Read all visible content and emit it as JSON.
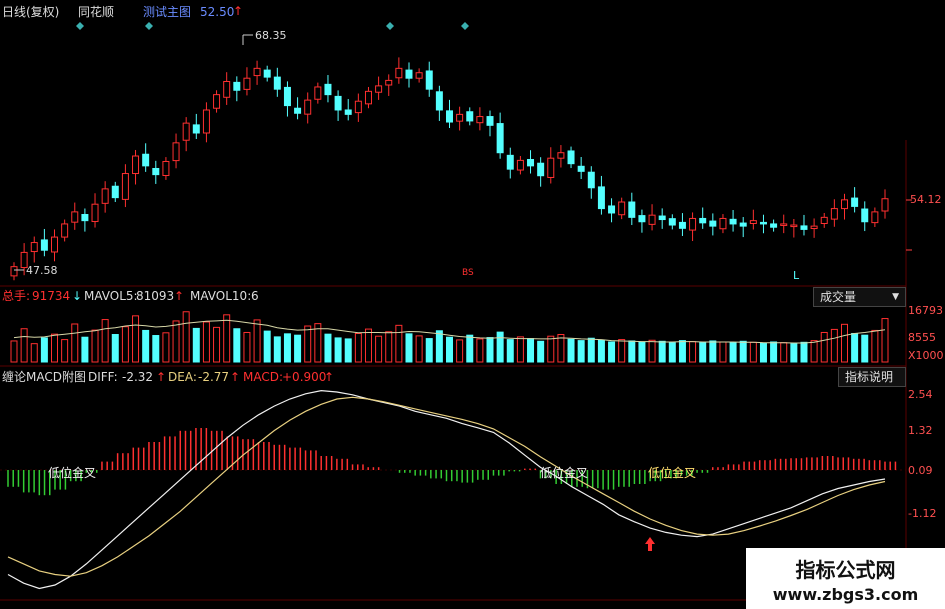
{
  "header": {
    "period_label": "日线(复权)",
    "software_label": "同花顺",
    "main_indicator_label": "测试主图",
    "main_indicator_value": "52.50"
  },
  "main": {
    "high_label": "68.35",
    "low_label": "47.58",
    "right_price": "54.12",
    "bottom_marker": "L"
  },
  "volume": {
    "total_label": "总手:",
    "total_value": "91734",
    "mavol5_label": "MAVOL5:",
    "mavol5_value": "81093",
    "mavol10_label": "MAVOL10:",
    "mavol10_value": "6",
    "selector_label": "成交量",
    "axis_top": "16793",
    "axis_mid": "8555",
    "axis_unit": "X1000"
  },
  "macd": {
    "title": "缠论MACD附图",
    "diff_label": "DIFF:",
    "diff_value": "-2.32",
    "dea_label": "DEA:",
    "dea_value": "-2.77",
    "macd_label": "MACD:",
    "macd_value": "+0.900",
    "help_button": "指标说明",
    "axis": [
      "2.54",
      "1.32",
      "0.09",
      "-1.12"
    ],
    "annotations": [
      "低位金叉",
      "低位金叉",
      "低位金叉"
    ]
  },
  "watermark": {
    "line1": "指标公式网",
    "line2": "www.zbgs3.com"
  },
  "chart_data": [
    {
      "type": "candlestick",
      "annotations": [
        "68.35",
        "47.58",
        "54.12"
      ],
      "up_color": "#ff3030",
      "down_color": "#54ffff",
      "close": [
        47.9,
        49.2,
        50.1,
        49.4,
        50.6,
        51.8,
        52.9,
        52.1,
        53.6,
        55.0,
        54.2,
        56.4,
        58.0,
        57.1,
        56.3,
        57.5,
        59.2,
        61.0,
        60.1,
        62.2,
        63.6,
        64.8,
        64.0,
        65.1,
        66.0,
        65.2,
        64.1,
        62.6,
        61.9,
        63.1,
        64.3,
        63.6,
        62.2,
        61.8,
        63.0,
        63.9,
        64.4,
        64.9,
        66.0,
        65.1,
        65.6,
        64.1,
        62.2,
        61.1,
        61.8,
        61.2,
        61.6,
        60.8,
        58.3,
        56.8,
        57.6,
        57.1,
        56.2,
        57.8,
        58.3,
        57.3,
        56.6,
        55.1,
        53.2,
        52.8,
        53.8,
        52.4,
        52.0,
        52.6,
        52.2,
        51.7,
        51.4,
        52.3,
        51.9,
        51.6,
        52.3,
        51.8,
        51.6,
        52.1,
        51.8,
        51.5,
        51.8,
        51.7,
        51.3,
        51.6,
        52.4,
        53.2,
        54.0,
        53.4,
        52.0,
        52.9,
        54.1
      ],
      "high_marker": 68.35,
      "low_marker": 47.58
    },
    {
      "type": "bar",
      "name": "成交量",
      "axis_ticks": [
        "16793",
        "8555"
      ],
      "values": [
        6200,
        9800,
        5400,
        7100,
        8200,
        6600,
        11200,
        7300,
        9400,
        12500,
        8100,
        10400,
        13600,
        9300,
        7800,
        8600,
        12100,
        14800,
        9900,
        11800,
        10200,
        13900,
        9800,
        8700,
        12400,
        9100,
        7400,
        8300,
        7900,
        10600,
        11300,
        8200,
        7100,
        6800,
        8400,
        9700,
        7600,
        8900,
        10800,
        8300,
        7700,
        6900,
        9200,
        7300,
        6500,
        7900,
        6800,
        7200,
        8800,
        6600,
        7400,
        6900,
        6100,
        7600,
        8100,
        6700,
        6300,
        7000,
        6400,
        5900,
        6600,
        6200,
        5800,
        6400,
        6100,
        5700,
        6300,
        6000,
        5800,
        6200,
        5900,
        5600,
        6100,
        5800,
        5500,
        5900,
        5700,
        5400,
        5800,
        6300,
        8700,
        9600,
        11100,
        8400,
        7900,
        9300,
        12800
      ],
      "mavol5": [
        7200,
        7500,
        7300,
        7400,
        7900,
        8200,
        8500,
        8900,
        9200,
        9800,
        10100,
        10600,
        10900,
        10700,
        10300,
        10500,
        10900,
        11400,
        11700,
        12000,
        12100,
        12300,
        12000,
        11600,
        11200,
        10800,
        10100,
        9700,
        9400,
        9500,
        9800,
        9800,
        9400,
        9000,
        8600,
        8700,
        8700,
        8600,
        8700,
        9000,
        8900,
        8600,
        8300,
        7900,
        7500,
        7300,
        7100,
        7000,
        7200,
        7000,
        6900,
        6900,
        6800,
        6800,
        7100,
        7000,
        6800,
        6700,
        6600,
        6300,
        6200,
        6100,
        6000,
        6000,
        5900,
        5900,
        6000,
        6000,
        5900,
        5900,
        5900,
        5900,
        5800,
        5800,
        5700,
        5700,
        5700,
        5600,
        5600,
        5800,
        6400,
        7000,
        7800,
        8400,
        8700,
        9100,
        9500
      ]
    },
    {
      "type": "line",
      "title": "缠论MACD附图",
      "series": [
        {
          "name": "DIFF",
          "values": [
            -2.7,
            -2.95,
            -3.1,
            -3.0,
            -2.75,
            -2.4,
            -2.0,
            -1.6,
            -1.2,
            -0.8,
            -0.4,
            0.0,
            0.4,
            0.8,
            1.2,
            1.55,
            1.85,
            2.1,
            2.3,
            2.45,
            2.54,
            2.5,
            2.42,
            2.3,
            2.2,
            2.1,
            1.95,
            1.85,
            1.75,
            1.6,
            1.48,
            1.35,
            1.05,
            0.7,
            0.35,
            0.1,
            -0.2,
            -0.45,
            -0.7,
            -1.0,
            -1.2,
            -1.38,
            -1.5,
            -1.58,
            -1.62,
            -1.55,
            -1.4,
            -1.25,
            -1.1,
            -0.95,
            -0.8,
            -0.6,
            -0.4,
            -0.25,
            -0.15,
            -0.05,
            0.02
          ]
        },
        {
          "name": "DEA",
          "values": [
            -2.2,
            -2.4,
            -2.6,
            -2.7,
            -2.75,
            -2.65,
            -2.45,
            -2.2,
            -1.9,
            -1.6,
            -1.25,
            -0.9,
            -0.5,
            -0.1,
            0.3,
            0.7,
            1.05,
            1.4,
            1.7,
            1.95,
            2.15,
            2.3,
            2.35,
            2.3,
            2.22,
            2.12,
            2.02,
            1.92,
            1.82,
            1.72,
            1.6,
            1.45,
            1.2,
            0.95,
            0.65,
            0.38,
            0.1,
            -0.15,
            -0.4,
            -0.65,
            -0.9,
            -1.12,
            -1.3,
            -1.45,
            -1.55,
            -1.58,
            -1.55,
            -1.45,
            -1.32,
            -1.18,
            -1.02,
            -0.85,
            -0.65,
            -0.45,
            -0.28,
            -0.15,
            -0.05
          ]
        }
      ],
      "histogram": [
        -0.6,
        -0.8,
        -0.9,
        -0.7,
        -0.4,
        -0.1,
        0.3,
        0.6,
        0.8,
        1.0,
        1.2,
        1.4,
        1.5,
        1.4,
        1.2,
        1.1,
        1.0,
        0.9,
        0.8,
        0.7,
        0.5,
        0.4,
        0.2,
        0.1,
        0.0,
        -0.1,
        -0.2,
        -0.3,
        -0.4,
        -0.45,
        -0.35,
        -0.2,
        -0.05,
        0.05,
        -0.3,
        -0.5,
        -0.6,
        -0.65,
        -0.7,
        -0.6,
        -0.5,
        -0.4,
        -0.3,
        -0.2,
        -0.1,
        0.1,
        0.2,
        0.3,
        0.35,
        0.4,
        0.42,
        0.45,
        0.5,
        0.45,
        0.4,
        0.35,
        0.3
      ],
      "ylim": [
        -3.2,
        2.7
      ]
    }
  ]
}
